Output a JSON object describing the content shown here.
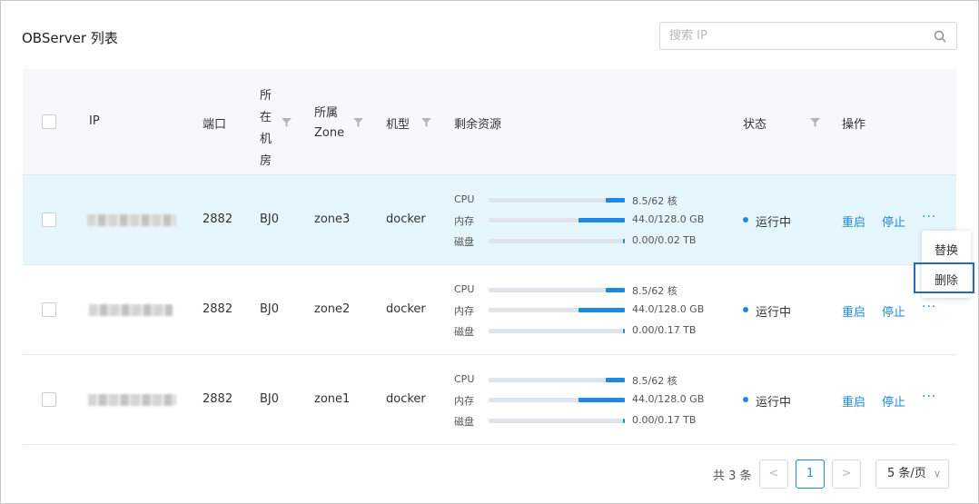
{
  "title": "OBServer 列表",
  "search": {
    "placeholder": "搜索 IP"
  },
  "columns": {
    "ip": "IP",
    "port": "端口",
    "idc": [
      "所",
      "在",
      "机",
      "房"
    ],
    "zone": [
      "所属",
      "Zone"
    ],
    "model": "机型",
    "resources": "剩余资源",
    "status": "状态",
    "actions": "操作"
  },
  "resource_labels": {
    "cpu": "CPU",
    "memory": "内存",
    "disk": "磁盘"
  },
  "rows": [
    {
      "port": "2882",
      "idc": "BJ0",
      "zone": "zone3",
      "model": "docker",
      "cpu": "8.5/62 核",
      "cpu_level": 0.14,
      "memory": "44.0/128.0 GB",
      "memory_level": 0.34,
      "disk": "0.00/0.02 TB",
      "disk_level": 0.01,
      "status": "运行中",
      "restart": "重启",
      "stop": "停止",
      "more": "···"
    },
    {
      "port": "2882",
      "idc": "BJ0",
      "zone": "zone2",
      "model": "docker",
      "cpu": "8.5/62 核",
      "cpu_level": 0.14,
      "memory": "44.0/128.0 GB",
      "memory_level": 0.34,
      "disk": "0.00/0.17 TB",
      "disk_level": 0.01,
      "status": "运行中",
      "restart": "重启",
      "stop": "停止",
      "more": "···"
    },
    {
      "port": "2882",
      "idc": "BJ0",
      "zone": "zone1",
      "model": "docker",
      "cpu": "8.5/62 核",
      "cpu_level": 0.14,
      "memory": "44.0/128.0 GB",
      "memory_level": 0.34,
      "disk": "0.00/0.17 TB",
      "disk_level": 0.01,
      "status": "运行中",
      "restart": "重启",
      "stop": "停止",
      "more": "···"
    }
  ],
  "dropdown": {
    "replace": "替换",
    "delete": "删除"
  },
  "pagination": {
    "total": "共 3 条",
    "prev": "<",
    "page": "1",
    "next": ">",
    "page_size": "5 条/页",
    "chevron": "∨"
  },
  "colors": {
    "accent": "#1e88e5",
    "highlight_row": "#e6f6fd",
    "header_bg": "#f7f8fa",
    "outline": "#2468c4"
  },
  "icons": {
    "search": "search-icon",
    "filter": "filter-icon"
  }
}
